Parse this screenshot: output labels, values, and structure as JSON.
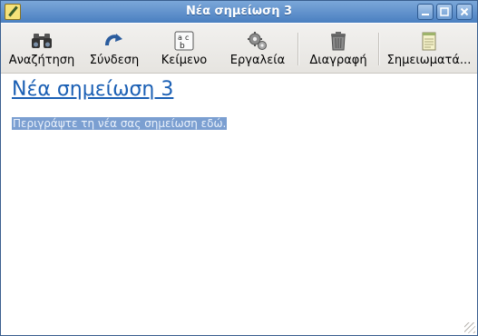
{
  "window": {
    "title": "Νέα σημείωση 3"
  },
  "toolbar": {
    "items": [
      {
        "label": "Αναζήτηση",
        "icon": "binoculars-icon"
      },
      {
        "label": "Σύνδεση",
        "icon": "link-arrow-icon"
      },
      {
        "label": "Κείμενο",
        "icon": "text-format-icon"
      },
      {
        "label": "Εργαλεία",
        "icon": "gears-icon"
      },
      {
        "label": "Διαγραφή",
        "icon": "trash-icon"
      },
      {
        "label": "Σημειωματά...",
        "icon": "notepad-icon"
      }
    ]
  },
  "note": {
    "title": "Νέα σημείωση 3",
    "body": "Περιγράψτε τη νέα σας σημείωση εδώ."
  },
  "colors": {
    "titlebar": "#4a7fc0",
    "link": "#1a5fb4",
    "selection": "#7b9fd1"
  }
}
